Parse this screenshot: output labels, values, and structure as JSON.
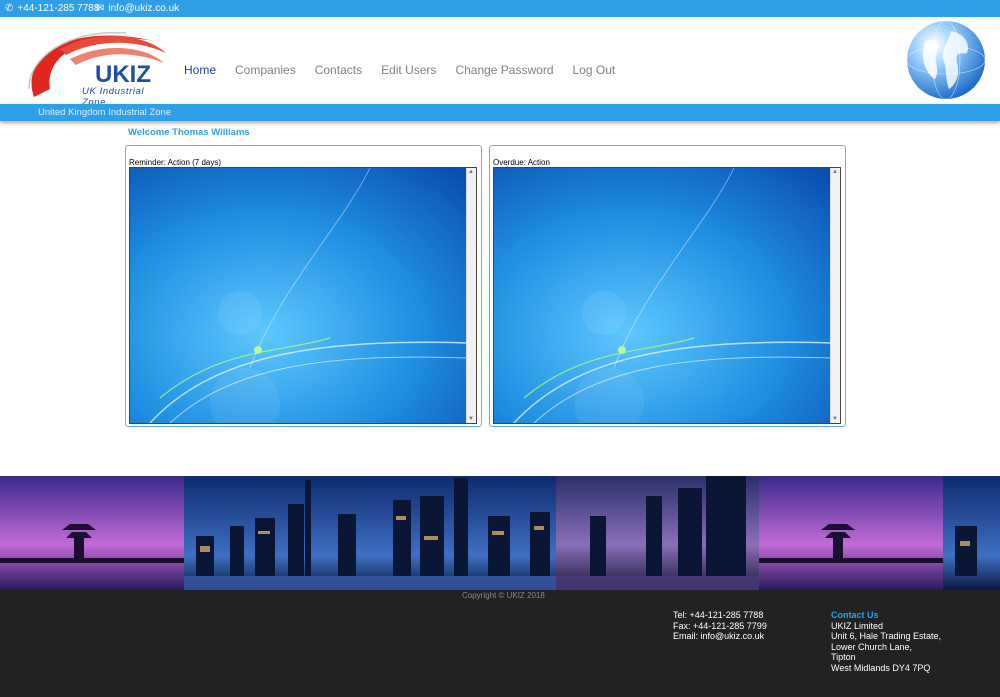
{
  "topbar": {
    "phone": "+44-121-285 7788",
    "email": "info@ukiz.co.uk",
    "phone_icon": "phone-icon",
    "email_icon": "envelope-icon"
  },
  "logo": {
    "name": "UKIZ",
    "subtitle": "UK Industrial Zone"
  },
  "nav": {
    "items": [
      "Home",
      "Companies",
      "Contacts",
      "Edit Users",
      "Change Password",
      "Log Out"
    ],
    "active": "Home"
  },
  "subbar": {
    "tagline": "United Kingdom Industrial Zone"
  },
  "main": {
    "welcome": "Welcome Thomas Williams",
    "panels": [
      {
        "label": "Reminder: Action (7 days)"
      },
      {
        "label": "Overdue: Action"
      }
    ]
  },
  "footer": {
    "copyright": "Copyright © UKIZ 2018",
    "tel": "Tel: +44-121-285 7788",
    "fax": "Fax: +44-121-285 7799",
    "email": "Email: info@ukiz.co.uk",
    "contact_title": "Contact Us",
    "address": [
      "UKIZ Limited",
      "Unit 6, Hale Trading Estate,",
      "Lower Church Lane,",
      "Tipton",
      "West Midlands DY4 7PQ"
    ]
  },
  "colors": {
    "accent": "#2f9fe8",
    "footer_bg": "#222222",
    "nav_active": "#1b3fa8"
  }
}
